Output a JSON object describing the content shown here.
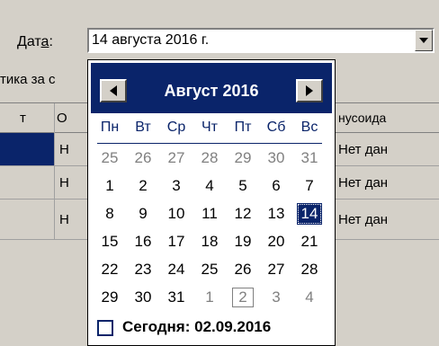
{
  "form": {
    "date_label_text": "Дат",
    "date_label_accel": "а",
    "date_label_colon": ":",
    "date_value": "14  августа  2016 г.",
    "stat_label": "тика за с"
  },
  "grid": {
    "headers": [
      "т",
      "О",
      "нусоида"
    ],
    "rows": [
      {
        "left": "",
        "mid": "Н",
        "right": "Нет дан"
      },
      {
        "left": "",
        "mid": "Н",
        "right": "Нет дан"
      },
      {
        "left": "",
        "mid": "Н",
        "right": "Нет дан"
      }
    ]
  },
  "calendar": {
    "month_title": "Август 2016",
    "weekdays": [
      "Пн",
      "Вт",
      "Ср",
      "Чт",
      "Пт",
      "Сб",
      "Вс"
    ],
    "weeks": [
      [
        {
          "d": "25",
          "o": true
        },
        {
          "d": "26",
          "o": true
        },
        {
          "d": "27",
          "o": true
        },
        {
          "d": "28",
          "o": true
        },
        {
          "d": "29",
          "o": true
        },
        {
          "d": "30",
          "o": true
        },
        {
          "d": "31",
          "o": true
        }
      ],
      [
        {
          "d": "1"
        },
        {
          "d": "2"
        },
        {
          "d": "3"
        },
        {
          "d": "4"
        },
        {
          "d": "5"
        },
        {
          "d": "6"
        },
        {
          "d": "7"
        }
      ],
      [
        {
          "d": "8"
        },
        {
          "d": "9"
        },
        {
          "d": "10"
        },
        {
          "d": "11"
        },
        {
          "d": "12"
        },
        {
          "d": "13"
        },
        {
          "d": "14",
          "sel": true
        }
      ],
      [
        {
          "d": "15"
        },
        {
          "d": "16"
        },
        {
          "d": "17"
        },
        {
          "d": "18"
        },
        {
          "d": "19"
        },
        {
          "d": "20"
        },
        {
          "d": "21"
        }
      ],
      [
        {
          "d": "22"
        },
        {
          "d": "23"
        },
        {
          "d": "24"
        },
        {
          "d": "25"
        },
        {
          "d": "26"
        },
        {
          "d": "27"
        },
        {
          "d": "28"
        }
      ],
      [
        {
          "d": "29"
        },
        {
          "d": "30"
        },
        {
          "d": "31"
        },
        {
          "d": "1",
          "o": true
        },
        {
          "d": "2",
          "o": true,
          "today": true
        },
        {
          "d": "3",
          "o": true
        },
        {
          "d": "4",
          "o": true
        }
      ]
    ],
    "today_text": "Сегодня: 02.09.2016",
    "prev_icon": "triangle-left-icon",
    "next_icon": "triangle-right-icon"
  },
  "colors": {
    "accent": "#0a246a",
    "window": "#d4d0c8"
  }
}
